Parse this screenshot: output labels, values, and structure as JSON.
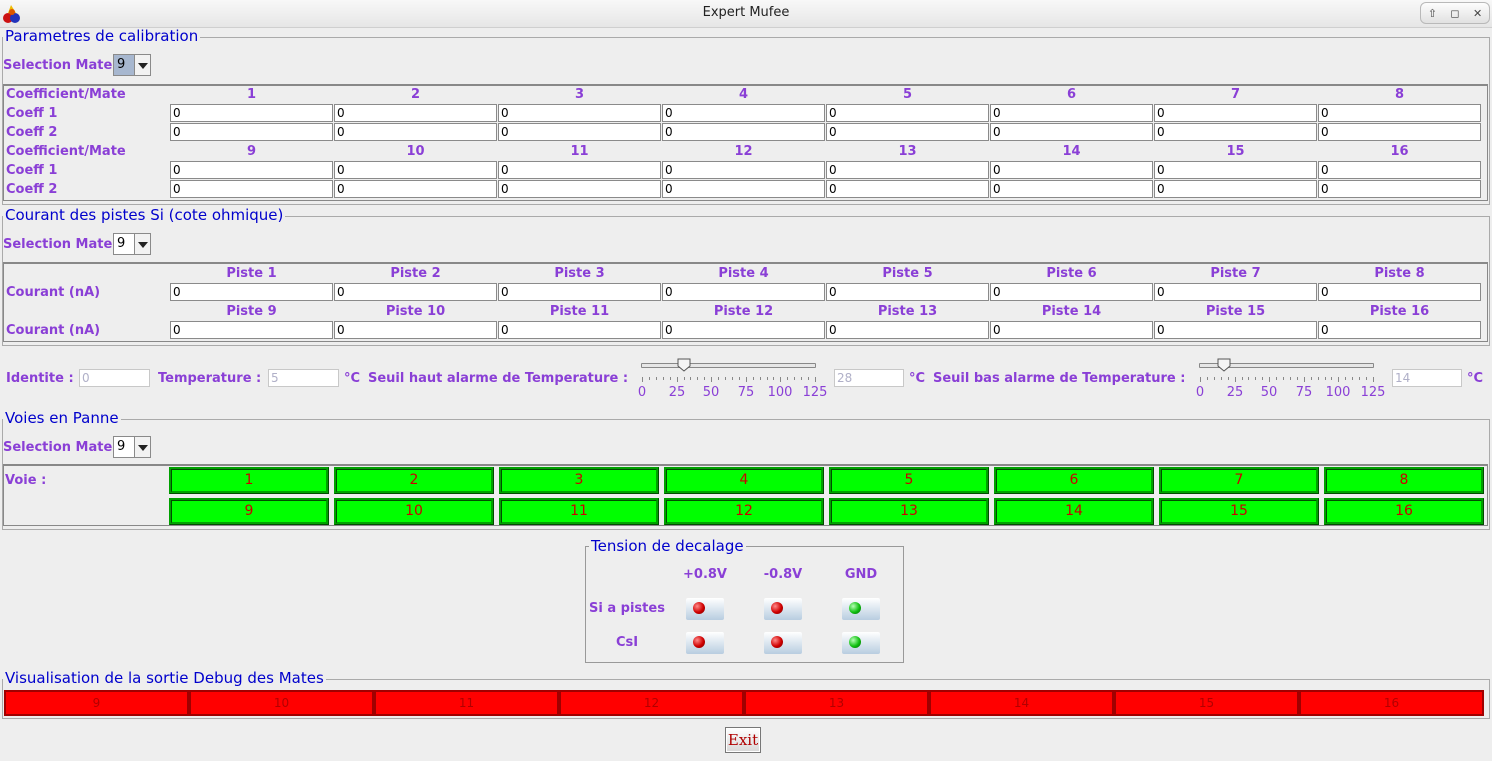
{
  "window": {
    "title": "Expert Mufee"
  },
  "calibration": {
    "title": "Parametres de calibration",
    "selection_label": "Selection Mate",
    "selection_value": "9",
    "rows": [
      {
        "header_label": "Coefficient/Mate",
        "mates": [
          "1",
          "2",
          "3",
          "4",
          "5",
          "6",
          "7",
          "8"
        ],
        "coeff1_label": "Coeff 1",
        "coeff1": [
          "0",
          "0",
          "0",
          "0",
          "0",
          "0",
          "0",
          "0"
        ],
        "coeff2_label": "Coeff 2",
        "coeff2": [
          "0",
          "0",
          "0",
          "0",
          "0",
          "0",
          "0",
          "0"
        ]
      },
      {
        "header_label": "Coefficient/Mate",
        "mates": [
          "9",
          "10",
          "11",
          "12",
          "13",
          "14",
          "15",
          "16"
        ],
        "coeff1_label": "Coeff 1",
        "coeff1": [
          "0",
          "0",
          "0",
          "0",
          "0",
          "0",
          "0",
          "0"
        ],
        "coeff2_label": "Coeff 2",
        "coeff2": [
          "0",
          "0",
          "0",
          "0",
          "0",
          "0",
          "0",
          "0"
        ]
      }
    ]
  },
  "courant": {
    "title": "Courant des pistes Si (cote ohmique)",
    "selection_label": "Selection Mate",
    "selection_value": "9",
    "rows": [
      {
        "label": "Courant (nA)",
        "pistes": [
          "Piste 1",
          "Piste 2",
          "Piste 3",
          "Piste 4",
          "Piste 5",
          "Piste 6",
          "Piste 7",
          "Piste 8"
        ],
        "values": [
          "0",
          "0",
          "0",
          "0",
          "0",
          "0",
          "0",
          "0"
        ]
      },
      {
        "label": "Courant (nA)",
        "pistes": [
          "Piste 9",
          "Piste 10",
          "Piste 11",
          "Piste 12",
          "Piste 13",
          "Piste 14",
          "Piste 15",
          "Piste 16"
        ],
        "values": [
          "0",
          "0",
          "0",
          "0",
          "0",
          "0",
          "0",
          "0"
        ]
      }
    ]
  },
  "status": {
    "identite_label": "Identite :",
    "identite_value": "0",
    "temperature_label": "Temperature :",
    "temperature_value": "5",
    "unit": "°C",
    "seuil_haut_label": "Seuil haut alarme de Temperature :",
    "seuil_haut_value": "28",
    "seuil_haut_slider": 28,
    "seuil_bas_label": "Seuil bas alarme de Temperature :",
    "seuil_bas_value": "14",
    "seuil_bas_slider": 14,
    "slider_min": 0,
    "slider_max": 125,
    "slider_ticks": [
      "0",
      "25",
      "50",
      "75",
      "100",
      "125"
    ]
  },
  "voies": {
    "title": "Voies en Panne",
    "selection_label": "Selection Mate",
    "selection_value": "9",
    "voie_label": "Voie :",
    "buttons": [
      "1",
      "2",
      "3",
      "4",
      "5",
      "6",
      "7",
      "8",
      "9",
      "10",
      "11",
      "12",
      "13",
      "14",
      "15",
      "16"
    ]
  },
  "tension": {
    "title": "Tension de decalage",
    "columns": [
      "+0.8V",
      "-0.8V",
      "GND"
    ],
    "rows": [
      {
        "label": "Si a  pistes",
        "leds": [
          "red",
          "red",
          "green"
        ]
      },
      {
        "label": "CsI",
        "leds": [
          "red",
          "red",
          "green"
        ]
      }
    ]
  },
  "debug": {
    "title": "Visualisation de la sortie Debug des Mates",
    "cells": [
      "9",
      "10",
      "11",
      "12",
      "13",
      "14",
      "15",
      "16"
    ]
  },
  "exit_label": "Exit"
}
